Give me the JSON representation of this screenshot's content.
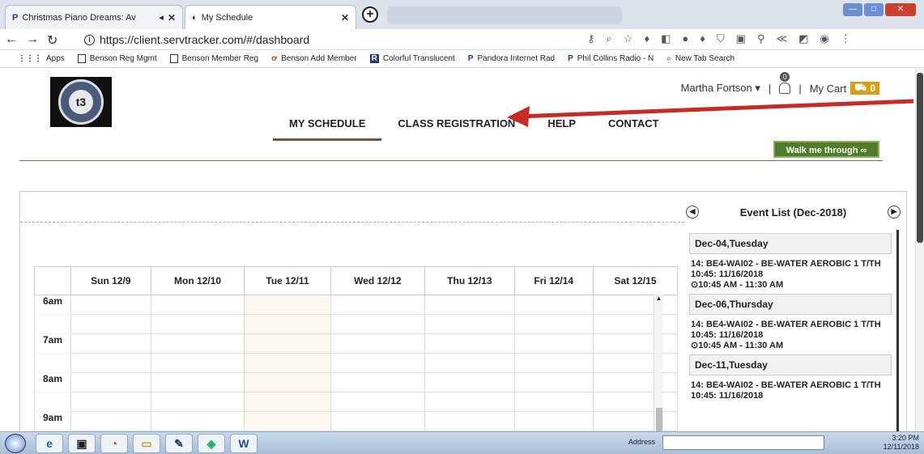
{
  "browser": {
    "tabs": [
      {
        "title": "Christmas Piano Dreams: Av"
      },
      {
        "title": "My Schedule"
      }
    ],
    "url": "https://client.servtracker.com/#/dashboard",
    "bookmarks": [
      {
        "label": "Apps"
      },
      {
        "label": "Benson Reg Mgmt"
      },
      {
        "label": "Benson Member Reg"
      },
      {
        "label": "Benson Add Member"
      },
      {
        "label": "Colorful Translucent"
      },
      {
        "label": "Pandora Internet Rad"
      },
      {
        "label": "Phil Collins Radio - N"
      },
      {
        "label": "New Tab Search"
      }
    ]
  },
  "header": {
    "user_name": "Martha Fortson",
    "notifications_count": "0",
    "cart_label": "My Cart",
    "cart_count": "0",
    "nav": [
      {
        "label": "MY SCHEDULE",
        "active": true
      },
      {
        "label": "CLASS REGISTRATION"
      },
      {
        "label": "HELP"
      },
      {
        "label": "CONTACT"
      }
    ],
    "walk_button": "Walk me through"
  },
  "calendar": {
    "days": [
      "Sun 12/9",
      "Mon 12/10",
      "Tue 12/11",
      "Wed 12/12",
      "Thu 12/13",
      "Fri 12/14",
      "Sat 12/15"
    ],
    "times": [
      "6am",
      "7am",
      "8am",
      "9am"
    ]
  },
  "events": {
    "title": "Event List (Dec-2018)",
    "items": [
      {
        "day": "Dec-04,Tuesday",
        "name": "14: BE4-WAI02 - BE-WATER AEROBIC 1 T/TH 10:45: 11/16/2018",
        "time": "⊙10:45 AM - 11:30 AM"
      },
      {
        "day": "Dec-06,Thursday",
        "name": "14: BE4-WAI02 - BE-WATER AEROBIC 1 T/TH 10:45: 11/16/2018",
        "time": "⊙10:45 AM - 11:30 AM"
      },
      {
        "day": "Dec-11,Tuesday",
        "name": "14: BE4-WAI02 - BE-WATER AEROBIC 1 T/TH 10:45: 11/16/2018",
        "time": ""
      }
    ]
  },
  "taskbar": {
    "address_label": "Address",
    "time": "3:20 PM",
    "date": "12/11/2018"
  }
}
